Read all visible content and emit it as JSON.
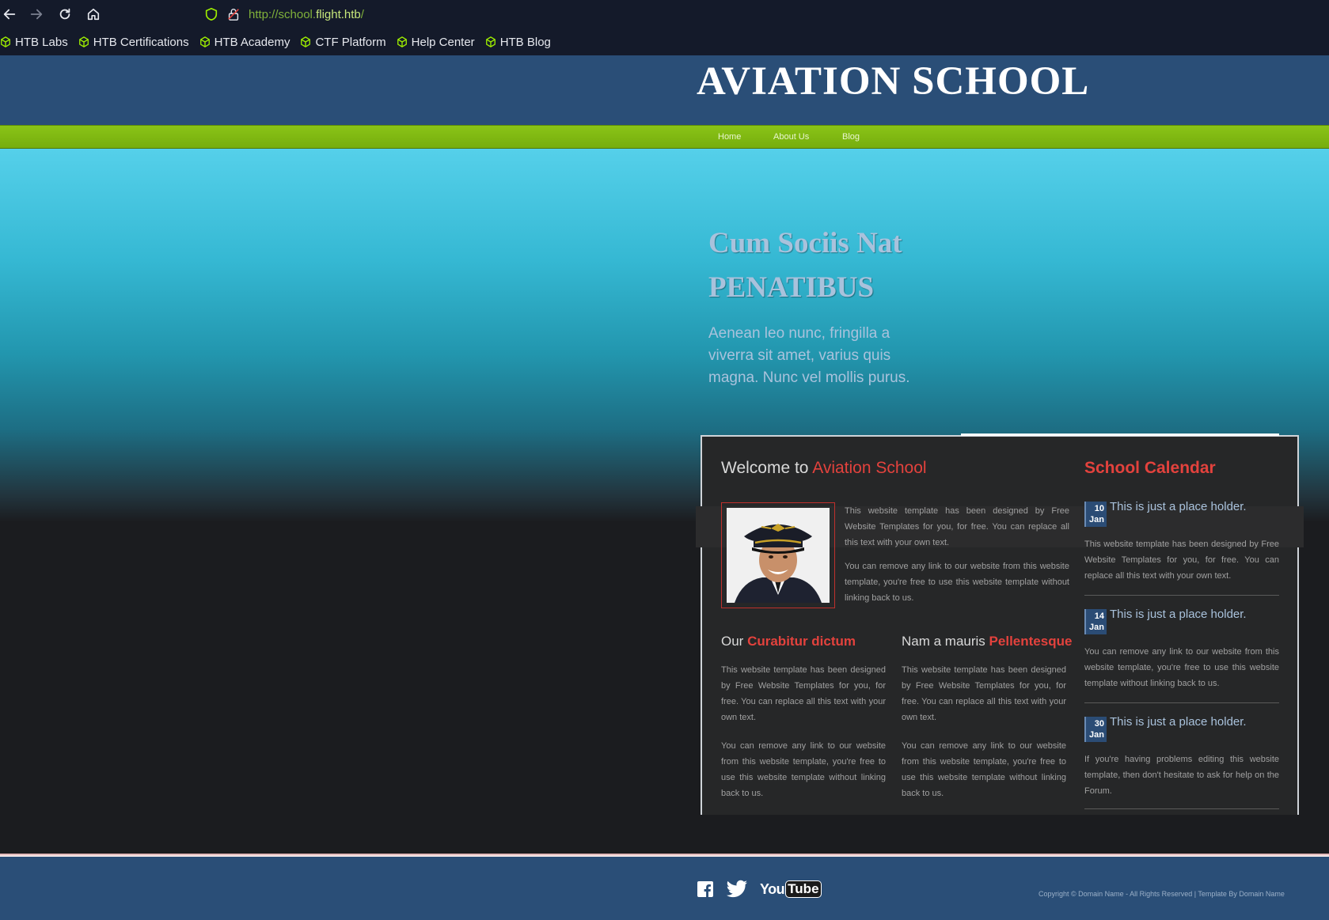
{
  "browser": {
    "url_prefix": "http://school.",
    "url_host": "flight.htb",
    "url_suffix": "/",
    "bookmarks": [
      {
        "label": "HTB Labs"
      },
      {
        "label": "HTB Certifications"
      },
      {
        "label": "HTB Academy"
      },
      {
        "label": "CTF Platform"
      },
      {
        "label": "Help Center"
      },
      {
        "label": "HTB Blog"
      }
    ],
    "accent_color": "#9fef00"
  },
  "site": {
    "title": "AVIATION SCHOOL",
    "nav": [
      {
        "label": "Home"
      },
      {
        "label": "About Us"
      },
      {
        "label": "Blog"
      }
    ]
  },
  "hero": {
    "heading_line1": "Cum Sociis Nat",
    "heading_line2": "PENATIBUS",
    "text": "Aenean leo nunc, fringilla a viverra sit amet, varius quis magna. Nunc vel mollis purus."
  },
  "welcome": {
    "heading_prefix": "Welcome to",
    "heading_highlight": "Aviation School",
    "para1": "This website template has been designed by Free Website Templates for you, for free. You can replace all this text with your own text.",
    "para2": "You can remove any link to our website from this website template, you're free to use this website template without linking back to us."
  },
  "columns": [
    {
      "heading_prefix": "Our",
      "heading_highlight": "Curabitur dictum",
      "para1": "This website template has been designed by Free Website Templates for you, for free. You can replace all this text with your own text.",
      "para2": "You can remove any link to our website from this website template, you're free to use this website template without linking back to us."
    },
    {
      "heading_prefix": "Nam a mauris",
      "heading_highlight": "Pellentesque",
      "para1": "This website template has been designed by Free Website Templates for you, for free. You can replace all this text with your own text.",
      "para2": "You can remove any link to our website from this website template, you're free to use this website template without linking back to us."
    }
  ],
  "calendar": {
    "heading": "School Calendar",
    "items": [
      {
        "day": "10",
        "month": "Jan",
        "title": "This is just a place holder.",
        "text": "This website template has been designed by Free Website Templates for you, for free. You can replace all this text with your own text."
      },
      {
        "day": "14",
        "month": "Jan",
        "title": "This is just a place holder.",
        "text": "You can remove any link to our website from this website template, you're free to use this website template without linking back to us."
      },
      {
        "day": "30",
        "month": "Jan",
        "title": "This is just a place holder.",
        "text": "If you're having problems editing this website template, then don't hesitate to ask for help on the Forum."
      }
    ]
  },
  "footer": {
    "social": [
      {
        "icon": "facebook-icon"
      },
      {
        "icon": "twitter-icon"
      },
      {
        "icon": "youtube-icon",
        "label_1": "You",
        "label_2": "Tube"
      }
    ],
    "copyright": "Copyright © Domain Name - All Rights Reserved | Template By Domain Name"
  }
}
